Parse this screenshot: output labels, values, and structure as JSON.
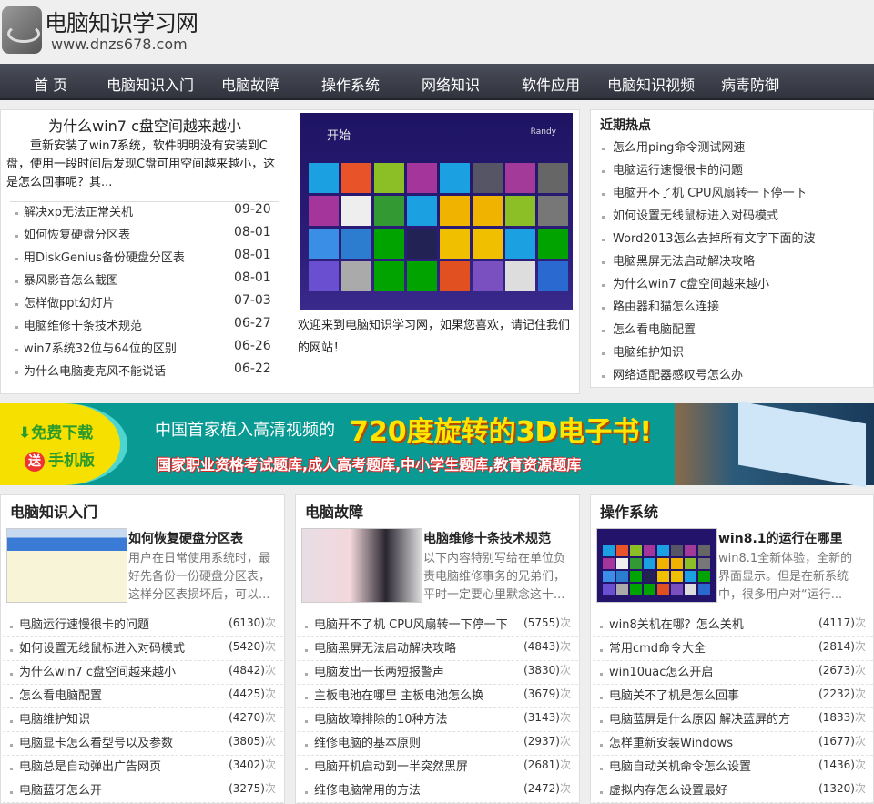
{
  "site": {
    "title": "电脑知识学习网",
    "url": "www.dnzs678.com"
  },
  "nav": [
    "首 页",
    "电脑知识入门",
    "电脑故障",
    "操作系统",
    "网络知识",
    "软件应用",
    "电脑知识视频",
    "病毒防御"
  ],
  "featured": {
    "title": "为什么win7 c盘空间越来越小",
    "desc": "重新安装了win7系统，软件明明没有安装到C盘，使用一段时间后发现C盘可用空间越来越小，这是怎么回事呢？其...",
    "list": [
      {
        "t": "解决xp无法正常关机",
        "d": "09-20"
      },
      {
        "t": "如何恢复硬盘分区表",
        "d": "08-01"
      },
      {
        "t": "用DiskGenius备份硬盘分区表",
        "d": "08-01"
      },
      {
        "t": "暴风影音怎么截图",
        "d": "08-01"
      },
      {
        "t": "怎样做ppt幻灯片",
        "d": "07-03"
      },
      {
        "t": "电脑维修十条技术规范",
        "d": "06-27"
      },
      {
        "t": "win7系统32位与64位的区别",
        "d": "06-26"
      },
      {
        "t": "为什么电脑麦克风不能说话",
        "d": "06-22"
      }
    ]
  },
  "slide": {
    "start": "开始",
    "user": "Randy",
    "caption": "欢迎来到电脑知识学习网，如果您喜欢，请记住我们的网站！"
  },
  "hot": {
    "title": "近期热点",
    "items": [
      "怎么用ping命令测试网速",
      "电脑运行速慢很卡的问题",
      "电脑开不了机 CPU风扇转一下停一下",
      "如何设置无线鼠标进入对码模式",
      "Word2013怎么去掉所有文字下面的波",
      "电脑黑屏无法启动解决攻略",
      "为什么win7 c盘空间越来越小",
      "路由器和猫怎么连接",
      "怎么看电脑配置",
      "电脑维护知识",
      "网络适配器感叹号怎么办"
    ]
  },
  "banner": {
    "download": "免费下载",
    "gift": "送",
    "mobile": "手机版",
    "head1": "中国首家植入高清视频的",
    "head2": "720度旋转的3D电子书!",
    "sub": "国家职业资格考试题库,成人高考题库,中小学生题库,教育资源题库"
  },
  "count_unit": "次",
  "columns": [
    {
      "title": "电脑知识入门",
      "head": "如何恢复硬盘分区表",
      "desc": "用户在日常使用系统时，最好先备份一份硬盘分区表，这样分区表损坏后，可以...",
      "items": [
        {
          "t": "电脑运行速慢很卡的问题",
          "n": "(6130)"
        },
        {
          "t": "如何设置无线鼠标进入对码模式",
          "n": "(5420)"
        },
        {
          "t": "为什么win7 c盘空间越来越小",
          "n": "(4842)"
        },
        {
          "t": "怎么看电脑配置",
          "n": "(4425)"
        },
        {
          "t": "电脑维护知识",
          "n": "(4270)"
        },
        {
          "t": "电脑显卡怎么看型号以及参数",
          "n": "(3805)"
        },
        {
          "t": "电脑总是自动弹出广告网页",
          "n": "(3402)"
        },
        {
          "t": "电脑蓝牙怎么开",
          "n": "(3275)"
        }
      ]
    },
    {
      "title": "电脑故障",
      "head": "电脑维修十条技术规范",
      "desc": "以下内容特别写给在单位负责电脑维修事务的兄弟们，平时一定要心里默念这十...",
      "items": [
        {
          "t": "电脑开不了机 CPU风扇转一下停一下",
          "n": "(5755)"
        },
        {
          "t": "电脑黑屏无法启动解决攻略",
          "n": "(4843)"
        },
        {
          "t": "电脑发出一长两短报警声",
          "n": "(3830)"
        },
        {
          "t": "主板电池在哪里 主板电池怎么换",
          "n": "(3679)"
        },
        {
          "t": "电脑故障排除的10种方法",
          "n": "(3143)"
        },
        {
          "t": "维修电脑的基本原则",
          "n": "(2937)"
        },
        {
          "t": "电脑开机启动到一半突然黑屏",
          "n": "(2681)"
        },
        {
          "t": "维修电脑常用的方法",
          "n": "(2472)"
        }
      ]
    },
    {
      "title": "操作系统",
      "head": "win8.1的运行在哪里",
      "desc": "win8.1全新体验，全新的界面显示。但是在新系统中，很多用户对“运行...",
      "items": [
        {
          "t": "win8关机在哪？怎么关机",
          "n": "(4117)"
        },
        {
          "t": "常用cmd命令大全",
          "n": "(2814)"
        },
        {
          "t": "win10uac怎么开启",
          "n": "(2673)"
        },
        {
          "t": "电脑关不了机是怎么回事",
          "n": "(2232)"
        },
        {
          "t": "电脑蓝屏是什么原因 解决蓝屏的方",
          "n": "(1833)"
        },
        {
          "t": "怎样重新安装Windows",
          "n": "(1677)"
        },
        {
          "t": "电脑自动关机命令怎么设置",
          "n": "(1436)"
        },
        {
          "t": "虚拟内存怎么设置最好",
          "n": "(1320)"
        }
      ]
    }
  ]
}
